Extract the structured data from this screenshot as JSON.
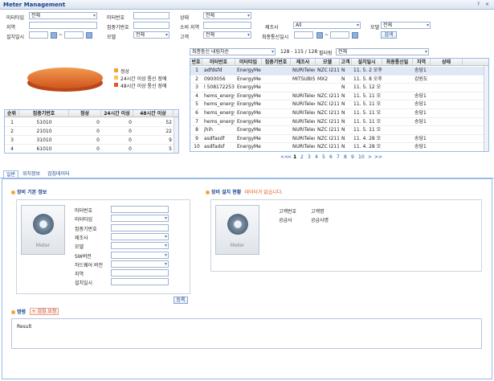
{
  "window": {
    "title": "Meter Management"
  },
  "search": {
    "meter_type_label": "미터타입",
    "meter_type_value": "전체",
    "meter_no_label": "미터번호",
    "meter_no_value": "",
    "status_label": "상태",
    "status_value": "전체",
    "region_label": "지역",
    "region_value": "",
    "concentrator_label": "집중기번호",
    "concentrator_value": "",
    "consumer_region_label": "소비 지역",
    "consumer_region_value": "",
    "manufacturer_label": "제조사",
    "manufacturer_value": "All",
    "model_label": "모델",
    "model_value": "전체",
    "install_date_label": "설치일시",
    "install_date_from": "",
    "install_date_to": "",
    "model2_label": "모델",
    "model2_value": "전체",
    "customer_label": "고객",
    "customer_value": "전체",
    "last_comm_label": "최종통신일시",
    "last_comm_from": "",
    "last_comm_to": "",
    "search_button": "검색"
  },
  "legend": [
    {
      "label": "정상",
      "color": "#f6a233"
    },
    {
      "label": "24시간 이상 통신 장애",
      "color": "#f7c65a"
    },
    {
      "label": "48시간 이상 통신 장애",
      "color": "#e8532a"
    }
  ],
  "stats_table": {
    "headers": [
      "순위",
      "집중기번호",
      "정상",
      "24시간 이상",
      "48시간 이상"
    ],
    "rows": [
      [
        "1",
        "51010",
        "0",
        "0",
        "52"
      ],
      [
        "2",
        "21010",
        "0",
        "0",
        "22"
      ],
      [
        "3",
        "31010",
        "0",
        "0",
        "9"
      ],
      [
        "4",
        "61010",
        "0",
        "0",
        "5"
      ]
    ]
  },
  "list_controls": {
    "sort_value": "최종통신 내림차순",
    "count_text": "128 - 115 / 128",
    "filter_label": "필터링",
    "filter_value": "전체"
  },
  "meter_table": {
    "headers": [
      "번호",
      "미터번호",
      "미터타입",
      "집중기번호",
      "제조사",
      "모델",
      "고객",
      "설치일시",
      "최종통신일",
      "지역",
      "상태"
    ],
    "rows": [
      [
        "1",
        "adfdsfd",
        "EnergyMete",
        "",
        "NURITeleco",
        "NZC I211",
        "N",
        "11. 5. 2 오후",
        "",
        "송당1",
        ""
      ],
      [
        "2",
        "0900056",
        "EnergyMete",
        "",
        "MITSUBISH",
        "MX2",
        "N",
        "11. 5. 8 오후",
        "",
        "강원도",
        ""
      ],
      [
        "3",
        "l 508172253",
        "EnergyMete",
        "",
        "",
        "",
        "N",
        "11. 5. 12 오",
        "",
        "",
        ""
      ],
      [
        "4",
        "hems_energy_met",
        "EnergyMete",
        "",
        "NURITeleco",
        "NZC I211",
        "N",
        "11. 5. 11 오",
        "",
        "송당1",
        ""
      ],
      [
        "5",
        "hems_energy_met",
        "EnergyMete",
        "",
        "NURITeleco",
        "NZC I211",
        "N",
        "11. 5. 11 오",
        "",
        "송당1",
        ""
      ],
      [
        "6",
        "hems_energy_met",
        "EnergyMete",
        "",
        "NURITeleco",
        "NZC I211",
        "N",
        "11. 5. 11 오",
        "",
        "송당1",
        ""
      ],
      [
        "7",
        "hems_energy_met",
        "EnergyMete",
        "",
        "NURITeleco",
        "NZC I211",
        "N",
        "11. 5. 11 오",
        "",
        "송당1",
        ""
      ],
      [
        "8",
        "jhih",
        "EnergyMete",
        "",
        "NURITeleco",
        "NZC I211",
        "N",
        "11. 5. 11 오",
        "",
        "",
        ""
      ],
      [
        "9",
        "asdfasdf",
        "EnergyMete",
        "",
        "NURITeleco",
        "NZC I211",
        "N",
        "11. 4. 28 오",
        "",
        "송당1",
        ""
      ],
      [
        "10",
        "asdfadsf",
        "EnergyMete",
        "",
        "NURITeleco",
        "NZC I211",
        "N",
        "11. 4. 28 오",
        "",
        "송당1",
        ""
      ]
    ]
  },
  "pagination": {
    "first": "<<",
    "prev": "<",
    "pages": [
      "1",
      "2",
      "3",
      "4",
      "5",
      "6",
      "7",
      "8",
      "9",
      "10"
    ],
    "next": ">",
    "last": ">>"
  },
  "tabs": [
    "일반",
    "위치정보",
    "검침데이터"
  ],
  "basic_info": {
    "title": "장비 기본 정보",
    "icon_label": "Meter",
    "fields": [
      "미터번호",
      "미터타입",
      "집중기번호",
      "제조사",
      "모델",
      "SW버전",
      "하드웨어 버전",
      "지역",
      "설치일시"
    ],
    "register_button": "등록"
  },
  "install_status": {
    "title": "장비 설치 현황",
    "no_data": "데이터가 없습니다.",
    "icon_label": "Meter",
    "rows": [
      [
        "고객번호",
        "고객명"
      ],
      [
        "공급사",
        "공급사명"
      ]
    ]
  },
  "command": {
    "title": "명령",
    "meter_read_button": "검침 요청",
    "result_text": "Result"
  }
}
